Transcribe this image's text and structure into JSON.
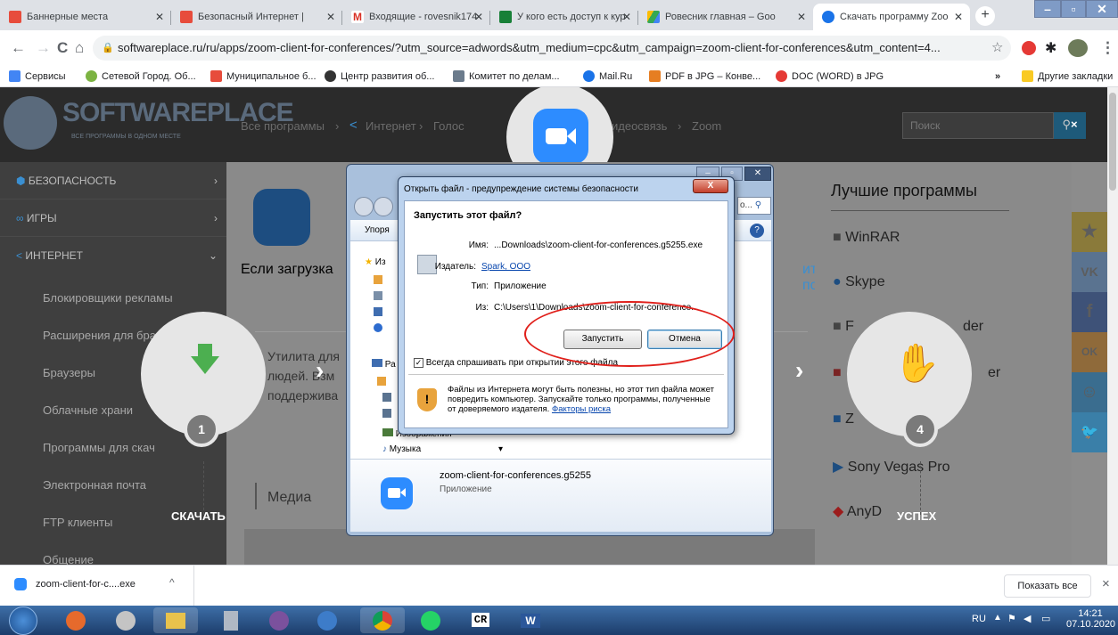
{
  "tabs": [
    {
      "label": "Баннерные места",
      "icon_color": "#e74c3c",
      "active": false
    },
    {
      "label": "Безопасный Интернет |",
      "icon_color": "#e74c3c",
      "active": false
    },
    {
      "label": "Входящие - rovesnik174",
      "icon_color": "#d93025",
      "active": false
    },
    {
      "label": "У кого есть доступ к кур",
      "icon_color": "#188038",
      "active": false
    },
    {
      "label": "Ровесник главная – Goo",
      "icon_color": "#fbbc04",
      "active": false
    },
    {
      "label": "Скачать программу Zoo",
      "icon_color": "#1a73e8",
      "active": true
    }
  ],
  "browser": {
    "new_tab": "+",
    "url": "softwareplace.ru/ru/apps/zoom-client-for-conferences/?utm_source=adwords&utm_medium=cpc&utm_campaign=zoom-client-for-conferences&utm_content=4...",
    "back": "←",
    "forward": "→",
    "reload": "C",
    "home": "⌂",
    "star": "☆",
    "menu": "⋮"
  },
  "bookmarks": [
    {
      "label": "Сервисы",
      "color": "#4285f4"
    },
    {
      "label": "Сетевой Город. Об...",
      "color": "#7cb342"
    },
    {
      "label": "Муниципальное б...",
      "color": "#e74c3c"
    },
    {
      "label": "Центр развития об...",
      "color": "#333333"
    },
    {
      "label": "Комитет по делам...",
      "color": "#6b7b8c"
    },
    {
      "label": "Mail.Ru",
      "color": "#1a73e8"
    },
    {
      "label": "PDF в JPG – Конве...",
      "color": "#e67e22"
    },
    {
      "label": "DOC (WORD) в JPG",
      "color": "#e53935"
    }
  ],
  "bookmarks_more": "»",
  "bookmarks_other": "Другие закладки",
  "site": {
    "logo_text": "SOFTWAREPLACE",
    "logo_sub": "ВСЕ ПРОГРАММЫ В ОДНОМ МЕСТЕ",
    "breadcrumb_all": "Все программы",
    "breadcrumb_internet": "Интернет",
    "breadcrumb_voice": "Голос",
    "breadcrumb_video": "идеосвязь",
    "breadcrumb_zoom": "Zoom",
    "search_placeholder": "Поиск",
    "search_close": "×"
  },
  "sidebar": {
    "categories": [
      {
        "label": "БЕЗОПАСНОСТЬ",
        "arrow": "›"
      },
      {
        "label": "ИГРЫ",
        "arrow": "›"
      },
      {
        "label": "ИНТЕРНЕТ",
        "arrow": "⌄"
      }
    ],
    "items": [
      "Блокировщики рекламы",
      "Расширения для бра",
      "Браузеры",
      "Облачные храни",
      "Программы для скач",
      "Электронная почта",
      "FTP клиенты",
      "Общение"
    ]
  },
  "main": {
    "notice": "Если загрузка",
    "retry": "ите попытку",
    "desc_1": "Утилита для",
    "desc_2": "людей. Взм",
    "desc_3": "поддержива",
    "media": "Медиа",
    "step1_num": "1",
    "step1_label": "СКАЧАТЬ",
    "step4_num": "4",
    "step4_label": "УСПЕХ"
  },
  "right": {
    "title": "Лучшие программы",
    "items": [
      "WinRAR",
      "Skype",
      "F",
      "der",
      "er",
      "Z",
      "Sony Vegas Pro",
      "AnyD"
    ]
  },
  "social": [
    "★",
    "VK",
    "f",
    "OK",
    "☺",
    "🐦"
  ],
  "explorer": {
    "organize": "Упоря",
    "favorites": "Из",
    "pictures": "Изображения",
    "music": "Музыка",
    "file_name": "zoom-client-for-conferences.g5255",
    "file_type": "Приложение",
    "search_hint": "о...",
    "row_initial": "Ра"
  },
  "dialog": {
    "title": "Открыть файл - предупреждение системы безопасности",
    "question": "Запустить этот файл?",
    "name_label": "Имя:",
    "name_value": "...Downloads\\zoom-client-for-conferences.g5255.exe",
    "publisher_label": "Издатель:",
    "publisher_value": "Spark, OOO",
    "type_label": "Тип:",
    "type_value": "Приложение",
    "from_label": "Из:",
    "from_value": "C:\\Users\\1\\Downloads\\zoom-client-for-conference...",
    "run": "Запустить",
    "cancel": "Отмена",
    "always_ask": "Всегда спрашивать при открытии этого файла",
    "warning": "Файлы из Интернета могут быть полезны, но этот тип файла может повредить компьютер. Запускайте только программы, полученные от доверяемого издателя.",
    "risk_link": "Факторы риска",
    "close": "X"
  },
  "download": {
    "file": "zoom-client-for-c....exe",
    "chevron": "^",
    "show_all": "Показать все",
    "close": "×"
  },
  "taskbar": {
    "lang": "RU",
    "time": "14:21",
    "date": "07.10.2020",
    "cr": "CR",
    "word": "W"
  }
}
